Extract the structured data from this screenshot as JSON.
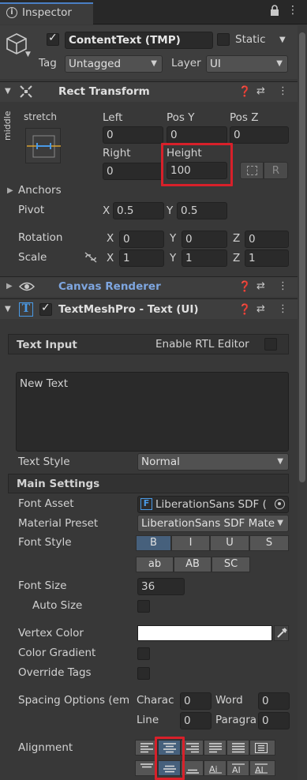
{
  "tab": {
    "title": "Inspector"
  },
  "gameobject": {
    "name": "ContentText (TMP)",
    "static_label": "Static",
    "tag_label": "Tag",
    "tag_value": "Untagged",
    "layer_label": "Layer",
    "layer_value": "UI"
  },
  "rect_transform": {
    "title": "Rect Transform",
    "anchor_top": "stretch",
    "anchor_side": "middle",
    "left_label": "Left",
    "left_value": "0",
    "posy_label": "Pos Y",
    "posy_value": "0",
    "posz_label": "Pos Z",
    "posz_value": "0",
    "right_label": "Right",
    "right_value": "0",
    "height_label": "Height",
    "height_value": "100",
    "r_button": "R",
    "anchors_label": "Anchors",
    "pivot_label": "Pivot",
    "pivot_x": "0.5",
    "pivot_y": "0.5",
    "rotation_label": "Rotation",
    "rot_x": "0",
    "rot_y": "0",
    "rot_z": "0",
    "scale_label": "Scale",
    "scale_x": "1",
    "scale_y": "1",
    "scale_z": "1",
    "x": "X",
    "y": "Y",
    "z": "Z"
  },
  "canvas_renderer": {
    "title": "Canvas Renderer"
  },
  "tmp": {
    "title": "TextMeshPro - Text (UI)",
    "text_input_label": "Text Input",
    "rtl_label": "Enable RTL Editor",
    "text_value": "New Text",
    "text_style_label": "Text Style",
    "text_style_value": "Normal",
    "main_settings_label": "Main Settings",
    "font_asset_label": "Font Asset",
    "font_asset_value": "LiberationSans SDF (",
    "material_preset_label": "Material Preset",
    "material_preset_value": "LiberationSans SDF Mate",
    "font_style_label": "Font Style",
    "style_b": "B",
    "style_i": "I",
    "style_u": "U",
    "style_s": "S",
    "style_ab": "ab",
    "style_AB": "AB",
    "style_sc": "SC",
    "font_size_label": "Font Size",
    "font_size_value": "36",
    "auto_size_label": "Auto Size",
    "vertex_color_label": "Vertex Color",
    "color_gradient_label": "Color Gradient",
    "override_tags_label": "Override Tags",
    "spacing_label": "Spacing Options (em",
    "charac_label": "Charac",
    "charac_value": "0",
    "word_label": "Word",
    "word_value": "0",
    "line_label": "Line",
    "line_value": "0",
    "paragra_label": "Paragra",
    "paragra_value": "0",
    "alignment_label": "Alignment"
  },
  "colors": {
    "highlight": "#d8202a",
    "selected_button": "#46607c",
    "vertex_color": "#ffffff"
  }
}
